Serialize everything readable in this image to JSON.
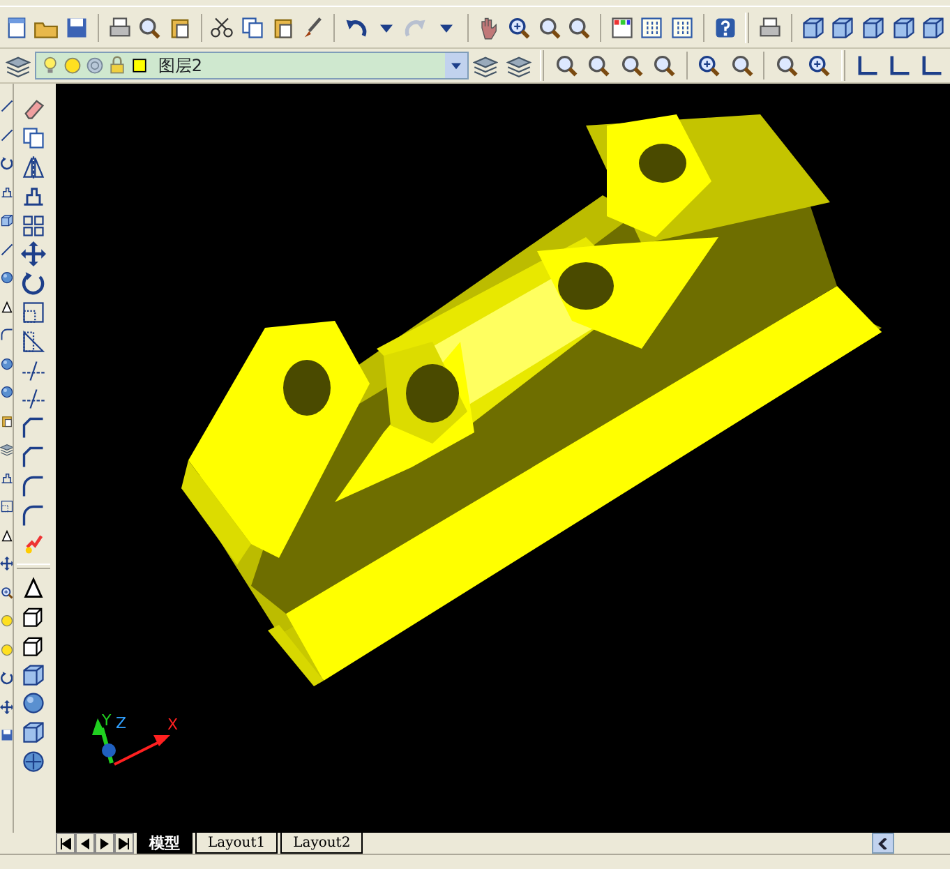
{
  "layer_toolbar": {
    "current_layer": "图层2"
  },
  "viewport": {
    "ucs_axes": [
      {
        "kind": "y",
        "label": "Y"
      },
      {
        "kind": "z",
        "label": "Z"
      },
      {
        "kind": "x",
        "label": "X"
      }
    ]
  },
  "layout_tabs": [
    {
      "label": "模型",
      "selected": true
    },
    {
      "label": "Layout1",
      "selected": false
    },
    {
      "label": "Layout2",
      "selected": false
    }
  ]
}
